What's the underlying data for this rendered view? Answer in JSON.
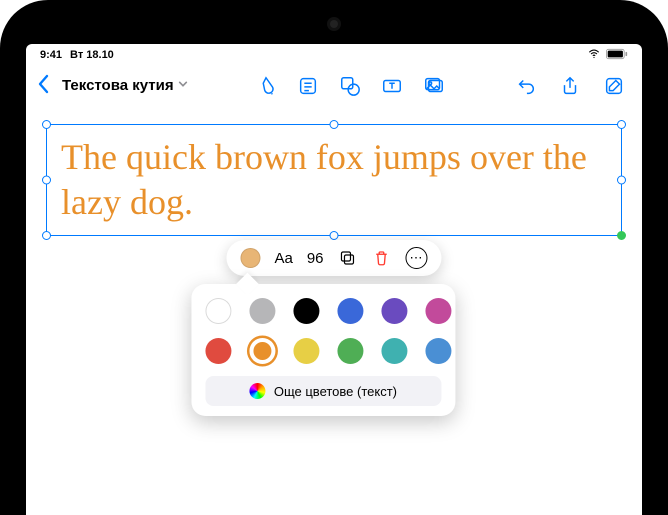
{
  "status": {
    "time": "9:41",
    "date": "Вт 18.10"
  },
  "toolbar": {
    "title": "Текстова кутия",
    "icons": {
      "back": "chevron-left",
      "draw": "pen-tip",
      "note": "square-lines",
      "shapes": "square-circle",
      "textbox": "text-box",
      "media": "photo",
      "undo": "arrow-counterclockwise",
      "share": "square-arrow-up",
      "compose": "square-pencil"
    }
  },
  "textbox": {
    "content": "The quick brown fox jumps over the lazy dog.",
    "font_size_label": "96",
    "font_button_label": "Aa",
    "text_color": "#e8902b"
  },
  "edit_bar": {
    "color_swatch": "#e8b575"
  },
  "color_popover": {
    "colors": [
      {
        "hex": "#ffffff",
        "name": "white",
        "bordered": true,
        "selected": false
      },
      {
        "hex": "#b6b6b8",
        "name": "gray",
        "bordered": false,
        "selected": false
      },
      {
        "hex": "#000000",
        "name": "black",
        "bordered": false,
        "selected": false
      },
      {
        "hex": "#3a68d9",
        "name": "blue",
        "bordered": false,
        "selected": false
      },
      {
        "hex": "#6a4bbf",
        "name": "purple",
        "bordered": false,
        "selected": false
      },
      {
        "hex": "#c24a9b",
        "name": "magenta",
        "bordered": false,
        "selected": false
      },
      {
        "hex": "#e04b3f",
        "name": "red",
        "bordered": false,
        "selected": false
      },
      {
        "hex": "#e8902b",
        "name": "orange",
        "bordered": false,
        "selected": true
      },
      {
        "hex": "#e7cf45",
        "name": "yellow",
        "bordered": false,
        "selected": false
      },
      {
        "hex": "#4fae55",
        "name": "green",
        "bordered": false,
        "selected": false
      },
      {
        "hex": "#3fb1b0",
        "name": "teal",
        "bordered": false,
        "selected": false
      },
      {
        "hex": "#4a8fd4",
        "name": "lightblue",
        "bordered": false,
        "selected": false
      }
    ],
    "more_label": "Още цветове (текст)"
  }
}
